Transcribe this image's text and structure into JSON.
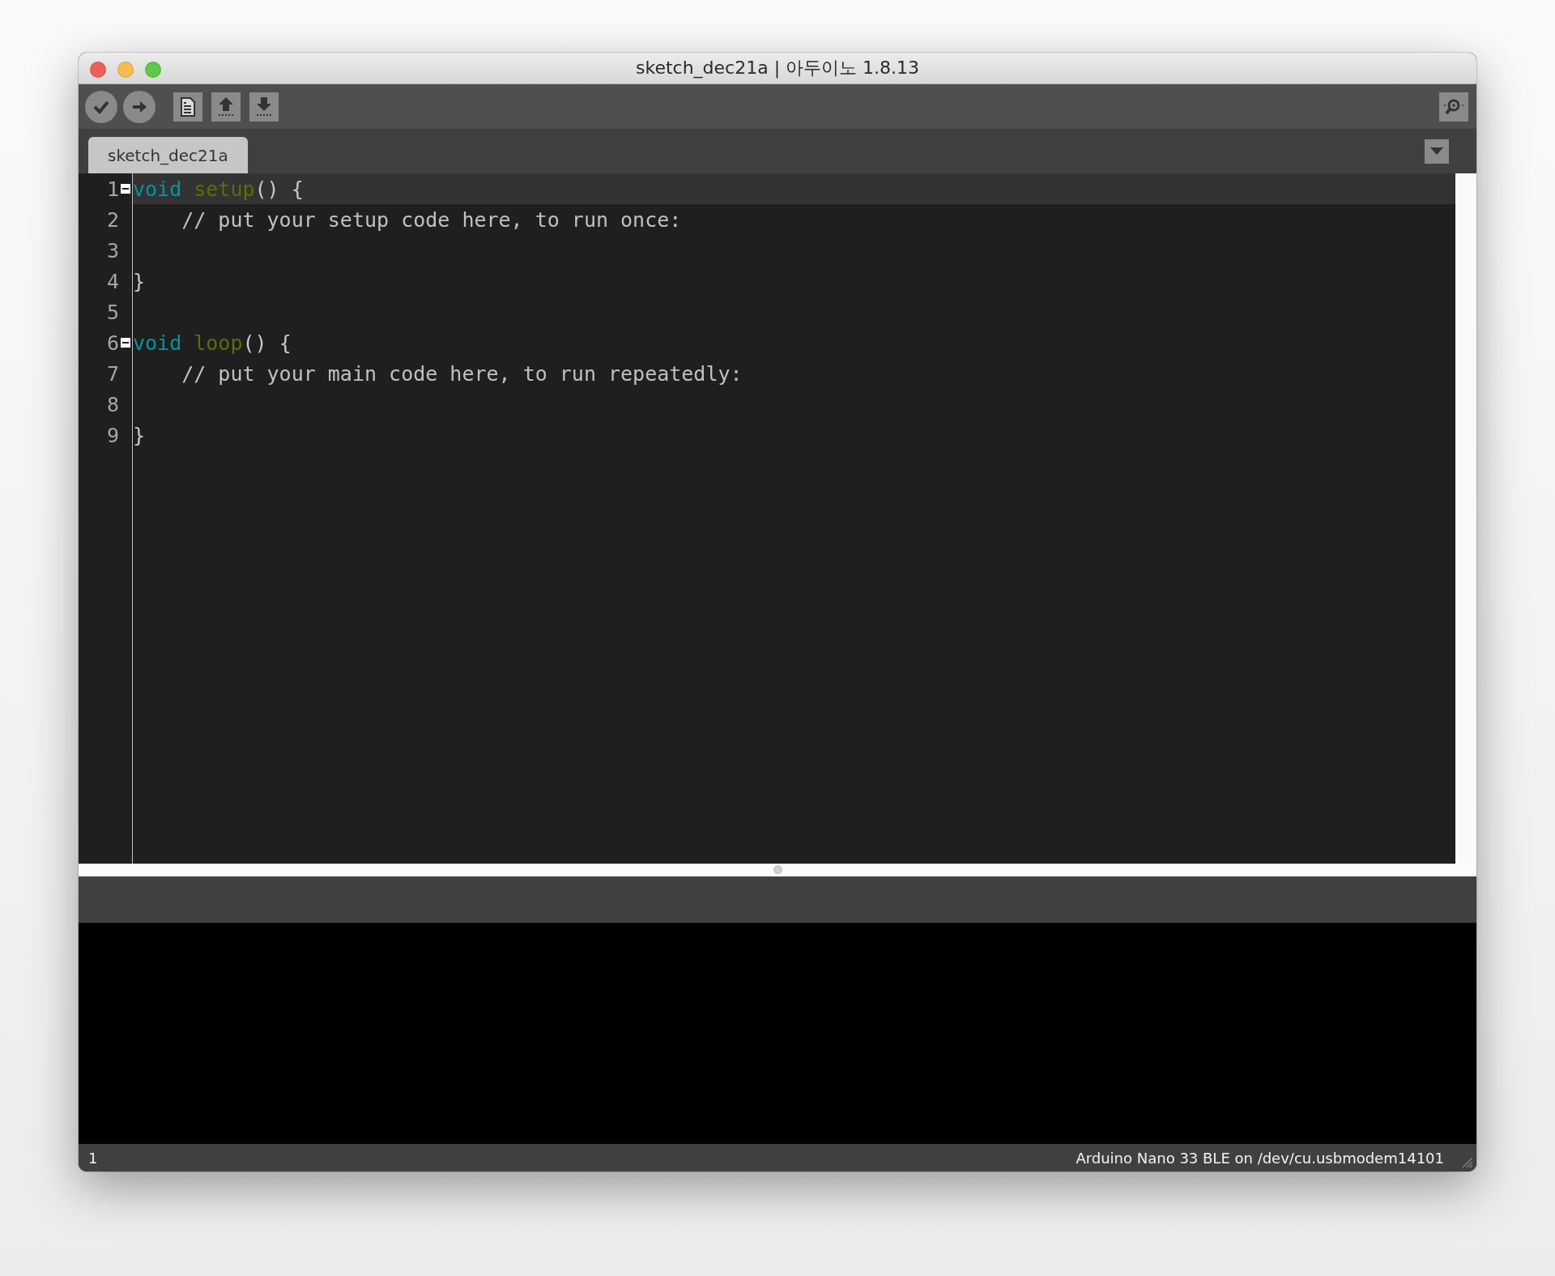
{
  "window": {
    "title": "sketch_dec21a | 아두이노 1.8.13"
  },
  "toolbar": {
    "buttons": [
      {
        "kind": "verify"
      },
      {
        "kind": "upload"
      },
      {
        "kind": "new"
      },
      {
        "kind": "open"
      },
      {
        "kind": "save"
      }
    ],
    "serial_monitor": {
      "kind": "monitor"
    }
  },
  "tabs": [
    {
      "label": "sketch_dec21a",
      "selected": true
    }
  ],
  "editor": {
    "lines": [
      {
        "number": "1",
        "foldable": true,
        "current": true,
        "tokens": [
          {
            "kind": "keyword",
            "text": "void"
          },
          {
            "kind": "function",
            "text": "setup"
          },
          {
            "kind": "plain",
            "text": "() {"
          }
        ]
      },
      {
        "number": "2",
        "current": false,
        "indented": true,
        "tokens": [
          {
            "kind": "comment",
            "text": "// put your setup code here, to run once:"
          }
        ]
      },
      {
        "number": "3",
        "current": false
      },
      {
        "number": "4",
        "current": false,
        "tokens": [
          {
            "kind": "plain",
            "text": "}"
          }
        ]
      },
      {
        "number": "5",
        "current": false
      },
      {
        "number": "6",
        "foldable": true,
        "current": false,
        "tokens": [
          {
            "kind": "keyword",
            "text": "void"
          },
          {
            "kind": "function",
            "text": "loop"
          },
          {
            "kind": "plain",
            "text": "() {"
          }
        ]
      },
      {
        "number": "7",
        "current": false,
        "indented": true,
        "tokens": [
          {
            "kind": "comment",
            "text": "// put your main code here, to run repeatedly:"
          }
        ]
      },
      {
        "number": "8",
        "current": false
      },
      {
        "number": "9",
        "current": false,
        "tokens": [
          {
            "kind": "plain",
            "text": "}"
          }
        ]
      }
    ]
  },
  "status_bar": {
    "line": "1",
    "board": "Arduino Nano 33 BLE on /dev/cu.usbmodem14101"
  }
}
